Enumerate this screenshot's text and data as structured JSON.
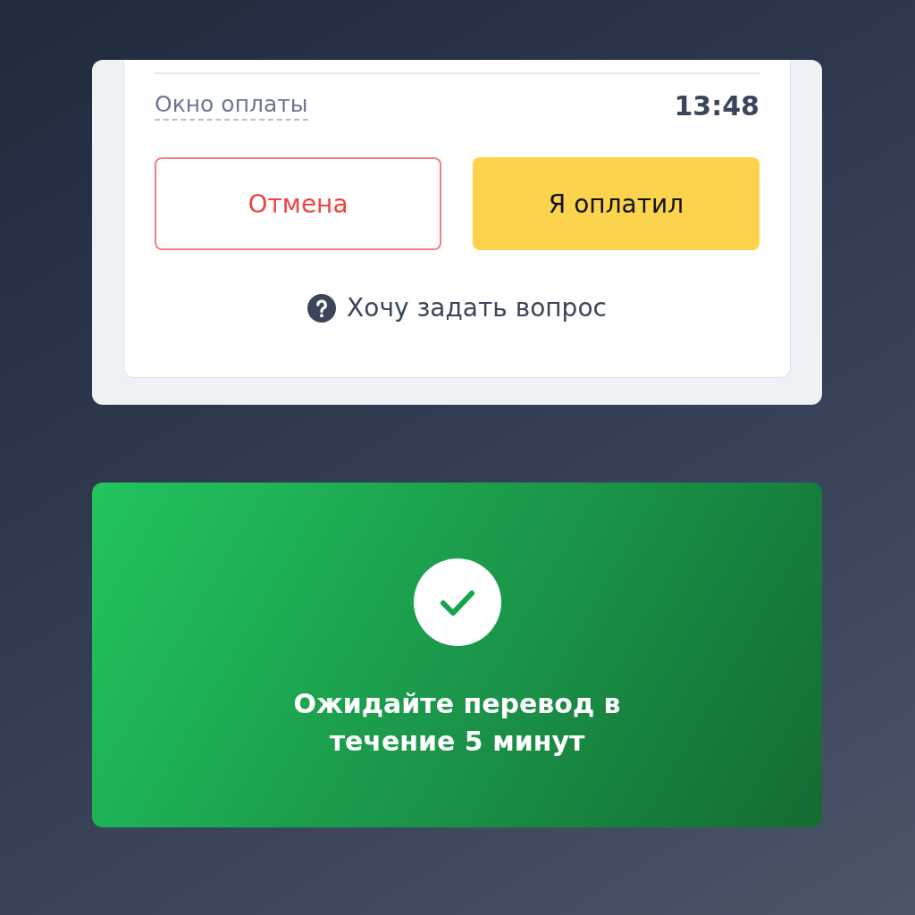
{
  "payment_card": {
    "window_label": "Окно оплаты",
    "timer": "13:48",
    "buttons": [
      {
        "label": "Отмена",
        "kind": "cancel"
      },
      {
        "label": "Я оплатил",
        "kind": "primary"
      }
    ],
    "help_link": "Хочу задать вопрос"
  },
  "status_card": {
    "message": "Ожидайте перевод в течение 5 минут"
  }
}
